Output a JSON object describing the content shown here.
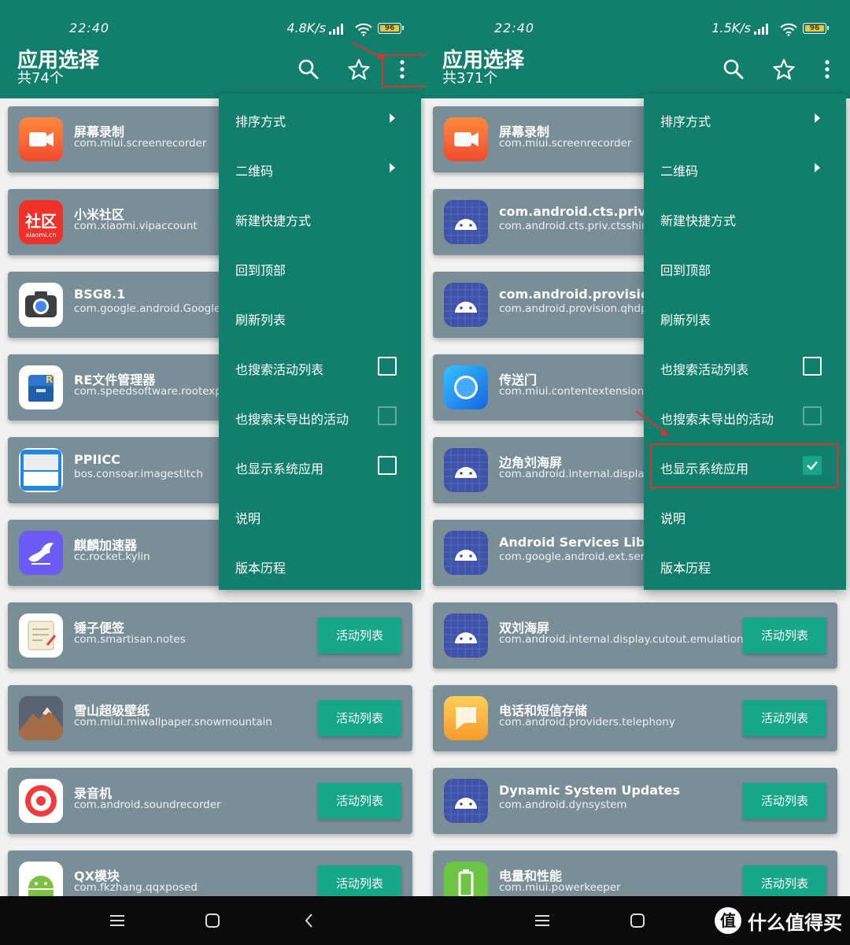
{
  "status_left": {
    "time": "22:40",
    "speed": "4.8K/s",
    "battery": "96"
  },
  "status_right": {
    "time": "22:40",
    "speed": "1.5K/s",
    "battery": "96"
  },
  "appbar_left": {
    "title": "应用选择",
    "subtitle": "共74个"
  },
  "appbar_right": {
    "title": "应用选择",
    "subtitle": "共371个"
  },
  "icons": {
    "search": "search-icon",
    "favorite": "star-icon",
    "more": "more-vert-icon"
  },
  "menu": {
    "items": [
      {
        "label": "排序方式"
      },
      {
        "label": "二维码"
      },
      {
        "label": "新建快捷方式"
      },
      {
        "label": "回到顶部"
      },
      {
        "label": "刷新列表"
      },
      {
        "label": "也搜索活动列表"
      },
      {
        "label": "也搜索未导出的活动"
      },
      {
        "label": "也显示系统应用"
      },
      {
        "label": "说明"
      },
      {
        "label": "版本历程"
      }
    ],
    "left_checkboxes": {
      "search_activities": false,
      "search_unexported": false,
      "show_system": false
    },
    "right_checkboxes": {
      "search_activities": false,
      "search_unexported": false,
      "show_system": true
    }
  },
  "action_button_label": "活动列表",
  "left_apps": [
    {
      "name": "屏幕录制",
      "pkg": "com.miui.screenrecorder",
      "icon": "screen-recorder-icon",
      "color": "#f26a35"
    },
    {
      "name": "小米社区",
      "pkg": "com.xiaomi.vipaccount",
      "icon": "xiaomi-community-icon",
      "color": "#f0302b",
      "icon_text": "社区",
      "icon_sub": "xiaomi.cn"
    },
    {
      "name": "BSG8.1",
      "pkg": "com.google.android.GoogleCamera",
      "icon": "camera-icon",
      "color": "#ffffff"
    },
    {
      "name": "RE文件管理器",
      "pkg": "com.speedsoftware.rootexplorer",
      "icon": "re-file-manager-icon",
      "color": "#ffffff"
    },
    {
      "name": "PPIICC",
      "pkg": "bos.consoar.imagestitch",
      "icon": "ppiicc-icon",
      "color": "#1e88e5"
    },
    {
      "name": "麒麟加速器",
      "pkg": "cc.rocket.kylin",
      "icon": "kylin-icon",
      "color": "#6b5cf6"
    },
    {
      "name": "锤子便签",
      "pkg": "com.smartisan.notes",
      "icon": "notes-icon",
      "color": "#ffffff"
    },
    {
      "name": "雪山超级壁纸",
      "pkg": "com.miui.miwallpaper.snowmountain",
      "icon": "snow-mountain-icon",
      "color": "#3b3f4a"
    },
    {
      "name": "录音机",
      "pkg": "com.android.soundrecorder",
      "icon": "sound-recorder-icon",
      "color": "#ffffff"
    },
    {
      "name": "QX模块",
      "pkg": "com.fkzhang.qqxposed",
      "icon": "android-green-icon",
      "color": "#ffffff"
    }
  ],
  "right_apps": [
    {
      "name": "屏幕录制",
      "pkg": "com.miui.screenrecorder",
      "icon": "screen-recorder-icon",
      "color": "#f26a35"
    },
    {
      "name": "com.android.cts.priv.ctsshim",
      "pkg": "com.android.cts.priv.ctsshim",
      "icon": "android-robot-icon",
      "color": "#3f51a8"
    },
    {
      "name": "com.android.provision.qhdpi",
      "pkg": "com.android.provision.qhdpi",
      "icon": "android-robot-icon",
      "color": "#3f51a8"
    },
    {
      "name": "传送门",
      "pkg": "com.miui.contentextension",
      "icon": "portal-icon",
      "color": "#2196f3"
    },
    {
      "name": "边角刘海屏",
      "pkg": "com.android.internal.display.cutout.emulation.corner",
      "icon": "android-robot-icon",
      "color": "#3f51a8"
    },
    {
      "name": "Android Services Library",
      "pkg": "com.google.android.ext.services",
      "icon": "android-robot-icon",
      "color": "#3f51a8"
    },
    {
      "name": "双刘海屏",
      "pkg": "com.android.internal.display.cutout.emulation.double",
      "icon": "android-robot-icon",
      "color": "#3f51a8"
    },
    {
      "name": "电话和短信存储",
      "pkg": "com.android.providers.telephony",
      "icon": "telephony-storage-icon",
      "color": "#f7a531"
    },
    {
      "name": "Dynamic System Updates",
      "pkg": "com.android.dynsystem",
      "icon": "android-robot-icon",
      "color": "#3f51a8"
    },
    {
      "name": "电量和性能",
      "pkg": "com.miui.powerkeeper",
      "icon": "battery-performance-icon",
      "color": "#6cc644"
    }
  ],
  "navbar": {
    "menu": "menu-icon",
    "home": "home-icon",
    "back": "back-icon"
  },
  "watermark": {
    "logo_text": "值",
    "text": "什么值得买"
  }
}
